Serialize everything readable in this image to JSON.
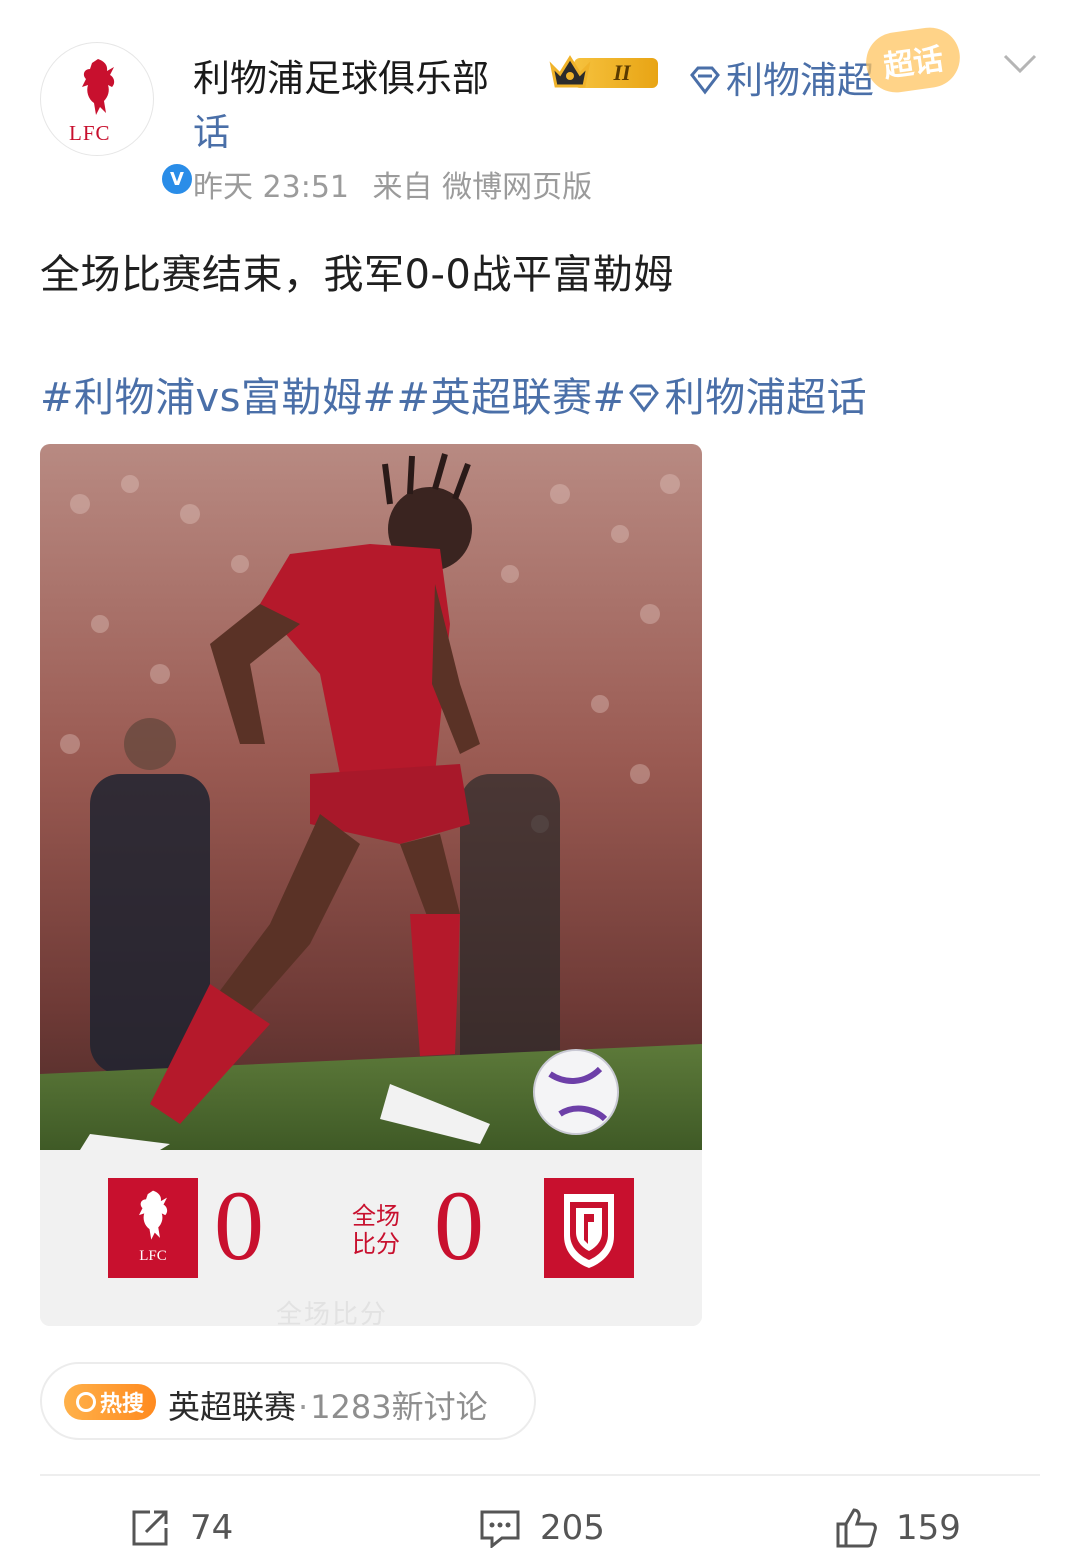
{
  "header": {
    "username": "利物浦足球俱乐部",
    "vip_level": "II",
    "super_topic_link": "利物浦超",
    "super_topic_link_cont": "话",
    "super_topic_badge": "超话",
    "avatar_text": "LFC",
    "verified_mark": "V"
  },
  "meta": {
    "time": "昨天 23:51",
    "source": "来自 微博网页版"
  },
  "post": {
    "text": "全场比赛结束，我军0-0战平富勒姆",
    "hashtag_1": "#利物浦vs富勒姆#",
    "hashtag_2": "#英超联赛#",
    "hashtag_3": "利物浦超话"
  },
  "scoreboard": {
    "home_badge_text": "LFC",
    "home_score": "0",
    "label_line1": "全场",
    "label_line2": "比分",
    "away_score": "0",
    "watermark": "全场比分"
  },
  "hot_search": {
    "tag": "热搜",
    "topic": "英超联赛",
    "separator": "·",
    "count": "1283新讨论"
  },
  "actions": {
    "share_count": "74",
    "comment_count": "205",
    "like_count": "159"
  },
  "colors": {
    "link_blue": "#4a6fa8",
    "lfc_red": "#c8102e",
    "hot_orange": "#ff8a1f",
    "vip_gold": "#f6c23e"
  },
  "icons": {
    "share": "share-icon",
    "comment": "comment-icon",
    "like": "thumbs-up-icon",
    "chevron": "chevron-down-icon",
    "diamond": "super-topic-diamond-icon"
  }
}
